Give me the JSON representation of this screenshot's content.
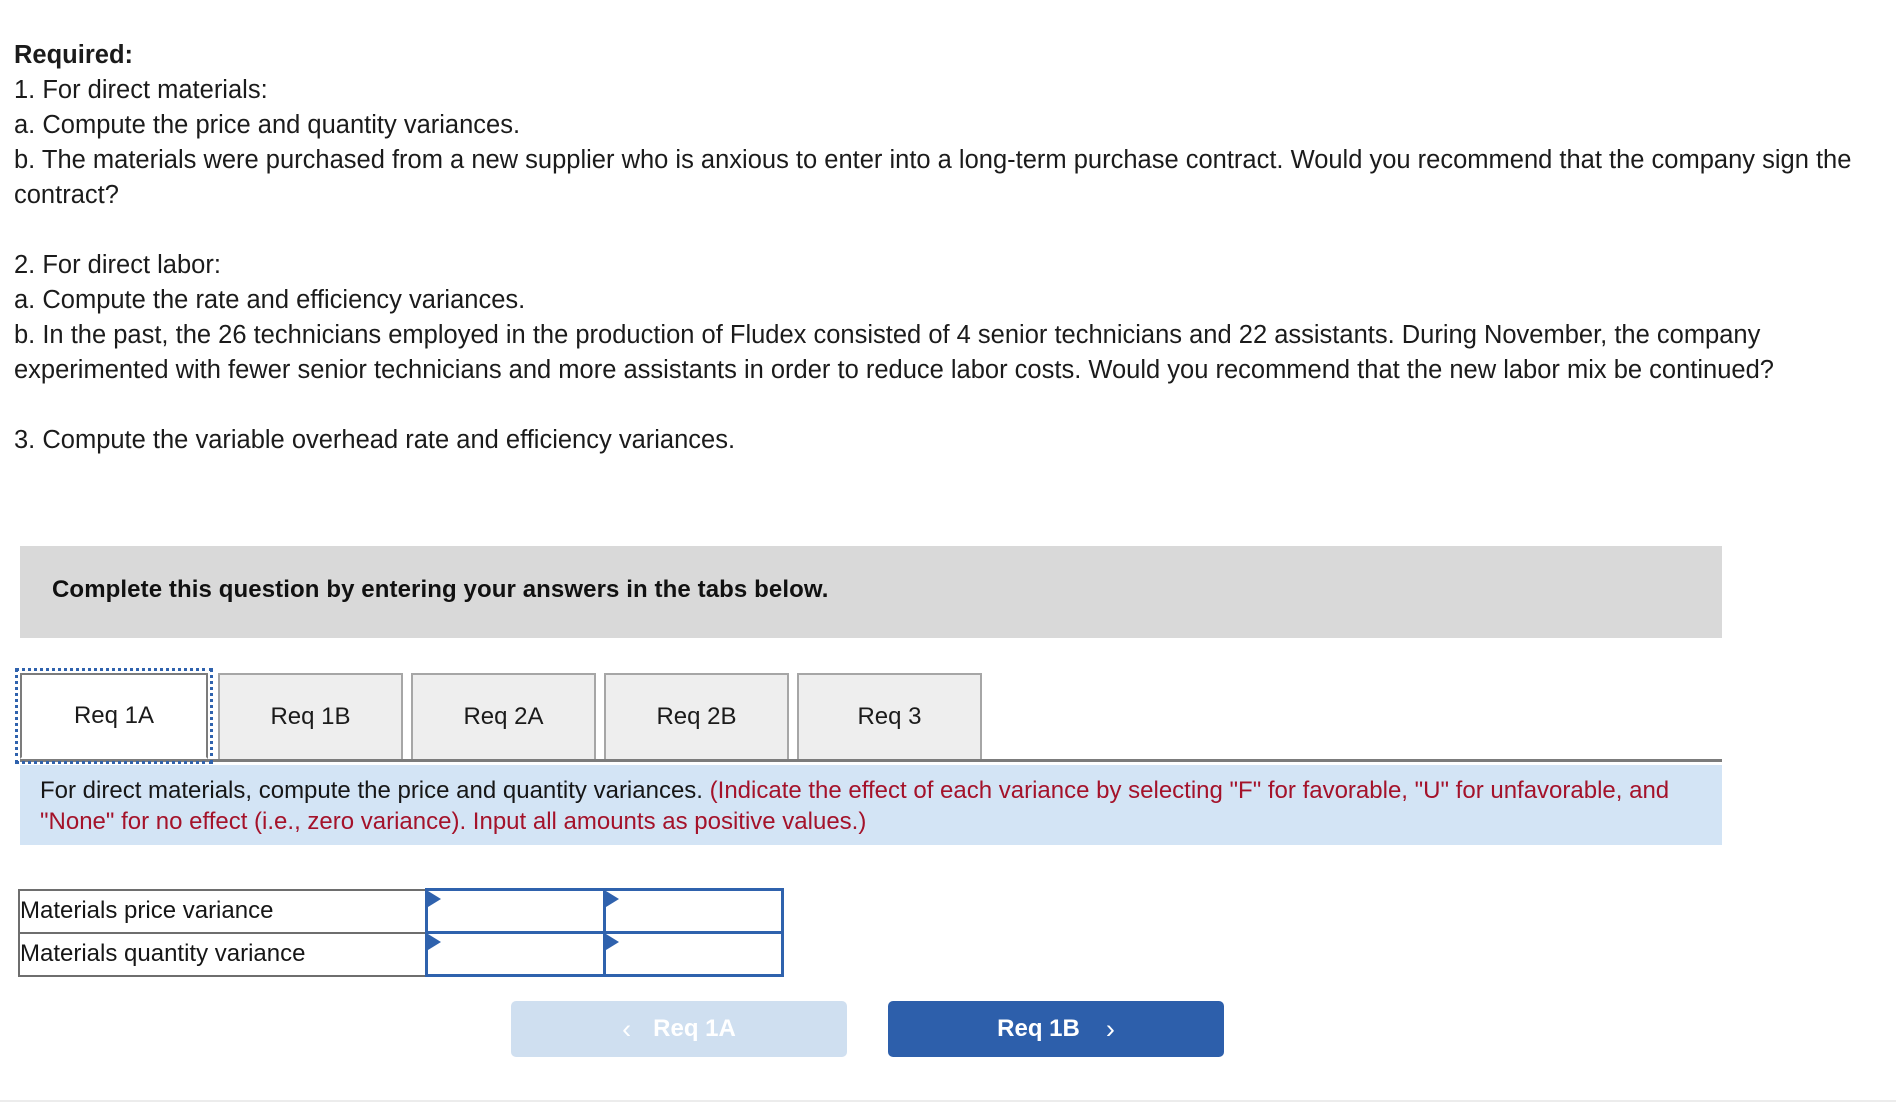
{
  "requirements": {
    "heading": "Required:",
    "lines": [
      "1. For direct materials:",
      "a. Compute the price and quantity variances.",
      "b. The materials were purchased from a new supplier who is anxious to enter into a long-term purchase contract. Would you recommend that the company sign the contract?",
      "2. For direct labor:",
      "a. Compute the rate and efficiency variances.",
      "b. In the past, the 26 technicians employed in the production of Fludex consisted of 4 senior technicians and 22 assistants. During November, the company experimented with fewer senior technicians and more assistants in order to reduce labor costs. Would you recommend that the new labor mix be continued?",
      "3. Compute the variable overhead rate and efficiency variances."
    ]
  },
  "banner": {
    "text": "Complete this question by entering your answers in the tabs below."
  },
  "tabs": [
    {
      "label": "Req 1A",
      "active": true
    },
    {
      "label": "Req 1B",
      "active": false
    },
    {
      "label": "Req 2A",
      "active": false
    },
    {
      "label": "Req 2B",
      "active": false
    },
    {
      "label": "Req 3",
      "active": false
    }
  ],
  "instruction": {
    "plain": "For direct materials, compute the price and quantity variances.",
    "red": "(Indicate the effect of each variance by selecting \"F\" for favorable, \"U\" for unfavorable, and \"None\" for no effect (i.e., zero variance). Input all amounts as positive values.)"
  },
  "answer_table": {
    "rows": [
      {
        "label": "Materials price variance",
        "amount": "",
        "effect": ""
      },
      {
        "label": "Materials quantity variance",
        "amount": "",
        "effect": ""
      }
    ]
  },
  "navigation": {
    "prev_label": "Req 1A",
    "prev_chevron": "‹",
    "next_label": "Req 1B",
    "next_chevron": "›"
  },
  "colors": {
    "banner_gray": "#d9d9d9",
    "instruction_blue": "#d3e4f5",
    "accent_blue": "#2d5fab",
    "disabled_blue": "#cfdff0",
    "red_text": "#a4122a",
    "tab_inactive": "#eeeeee"
  }
}
